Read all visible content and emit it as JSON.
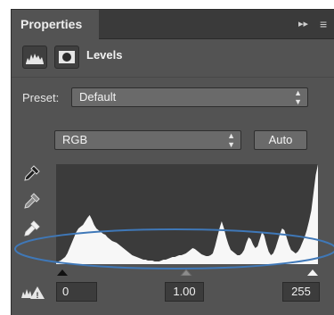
{
  "panel": {
    "tab_title": "Properties",
    "expand_glyph": "▸▸",
    "menu_glyph": "≡",
    "header_title": "Levels",
    "icons": [
      "levels-adjustment-icon",
      "layer-mask-icon"
    ]
  },
  "preset": {
    "label": "Preset:",
    "value": "Default"
  },
  "channel": {
    "value": "RGB",
    "auto_label": "Auto"
  },
  "droppers": [
    "black-point-eyedropper-icon",
    "gray-point-eyedropper-icon",
    "white-point-eyedropper-icon"
  ],
  "input_levels": {
    "black": "0",
    "midtone": "1.00",
    "white": "255"
  },
  "histogram_shape": [
    2,
    3,
    4,
    6,
    8,
    12,
    18,
    24,
    30,
    36,
    40,
    42,
    44,
    48,
    52,
    55,
    50,
    44,
    40,
    38,
    36,
    34,
    33,
    30,
    28,
    26,
    25,
    24,
    22,
    20,
    18,
    16,
    14,
    12,
    10,
    9,
    8,
    7,
    6,
    5,
    5,
    4,
    4,
    4,
    3,
    3,
    3,
    4,
    5,
    5,
    6,
    7,
    8,
    8,
    9,
    10,
    10,
    11,
    12,
    14,
    16,
    18,
    17,
    15,
    13,
    11,
    10,
    9,
    9,
    10,
    12,
    20,
    30,
    40,
    48,
    40,
    30,
    22,
    16,
    14,
    12,
    10,
    10,
    12,
    16,
    24,
    30,
    28,
    22,
    18,
    20,
    28,
    36,
    32,
    22,
    14,
    10,
    12,
    18,
    26,
    34,
    40,
    38,
    30,
    22,
    16,
    14,
    12,
    14,
    18,
    24,
    30,
    38,
    48,
    60,
    80,
    100,
    112
  ],
  "colors": {
    "panel_bg": "#535353",
    "annotation_ellipse": "#3f78b8"
  }
}
